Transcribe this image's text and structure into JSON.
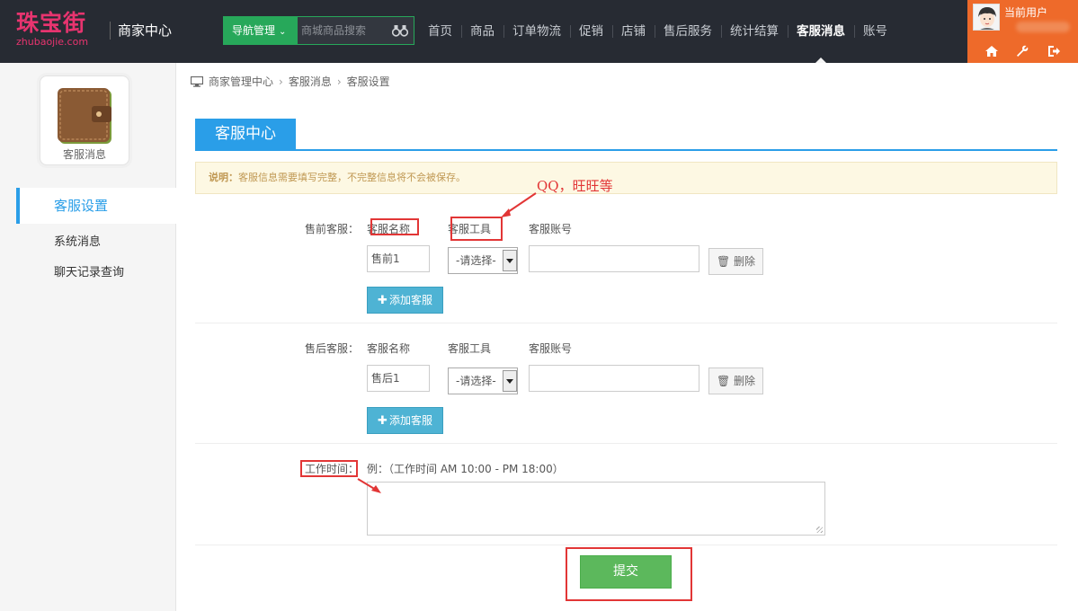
{
  "header": {
    "logo_cn": "珠宝街",
    "logo_en": "zhubaojie.com",
    "brand_title": "商家中心",
    "nav_button_label": "导航管理",
    "search_placeholder": "商城商品搜索",
    "nav_items": [
      "首页",
      "商品",
      "订单物流",
      "促销",
      "店铺",
      "售后服务",
      "统计结算",
      "客服消息",
      "账号"
    ],
    "active_nav_index": 7,
    "user_label": "当前用户"
  },
  "sidebar": {
    "card_label": "客服消息",
    "menu": [
      "客服设置",
      "系统消息",
      "聊天记录查询"
    ],
    "active_index": 0
  },
  "breadcrumb": [
    "商家管理中心",
    "客服消息",
    "客服设置"
  ],
  "panel": {
    "title": "客服中心",
    "notice_label": "说明：",
    "notice_text": "客服信息需要填写完整，不完整信息将不会被保存。"
  },
  "form": {
    "columns": [
      "客服名称",
      "客服工具",
      "客服账号"
    ],
    "presale": {
      "label": "售前客服：",
      "name_value": "售前1",
      "tool_value": "-请选择-",
      "account_value": "",
      "delete_label": "删除",
      "add_label": "添加客服"
    },
    "aftersale": {
      "label": "售后客服：",
      "name_value": "售后1",
      "tool_value": "-请选择-",
      "account_value": "",
      "delete_label": "删除",
      "add_label": "添加客服"
    },
    "work_time": {
      "label": "工作时间：",
      "hint": "例：（工作时间 AM 10:00 - PM 18:00）",
      "value": ""
    },
    "submit_label": "提交"
  },
  "annotation": {
    "text": "QQ，旺旺等",
    "color": "#e23636"
  },
  "colors": {
    "header_bg": "#272b33",
    "brand_pink": "#e8346f",
    "nav_green": "#27a85a",
    "user_orange": "#ee6a2a",
    "accent_blue": "#2a9ee8",
    "add_button": "#4eb3d4",
    "submit_green": "#5cb85c"
  }
}
